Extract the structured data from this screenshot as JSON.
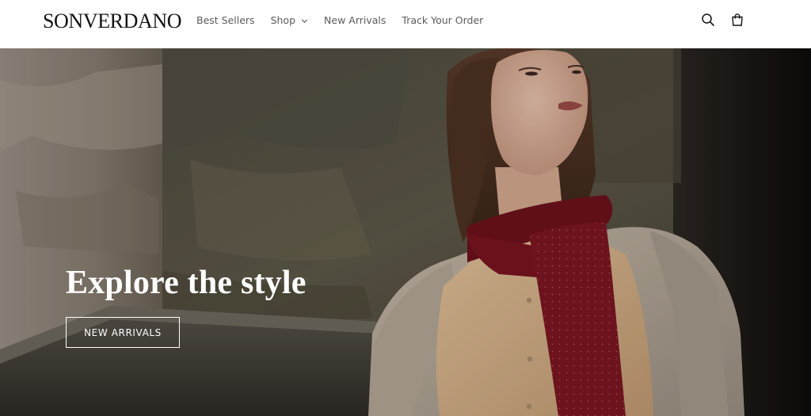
{
  "header": {
    "logo": "SONVERDANO",
    "nav": [
      {
        "label": "Best Sellers"
      },
      {
        "label": "Shop",
        "has_dropdown": true
      },
      {
        "label": "New Arrivals"
      },
      {
        "label": "Track Your Order"
      }
    ],
    "icons": [
      "search-icon",
      "cart-icon"
    ]
  },
  "hero": {
    "title": "Explore the style",
    "button_label": "NEW ARRIVALS"
  },
  "colors": {
    "header_bg": "#ffffff",
    "logo": "#121212",
    "nav_text": "#5b5b5b",
    "hero_text": "#ffffff",
    "scarf": "#7a1420",
    "coat": "#b8ab9c",
    "shirt": "#d9b48a"
  }
}
